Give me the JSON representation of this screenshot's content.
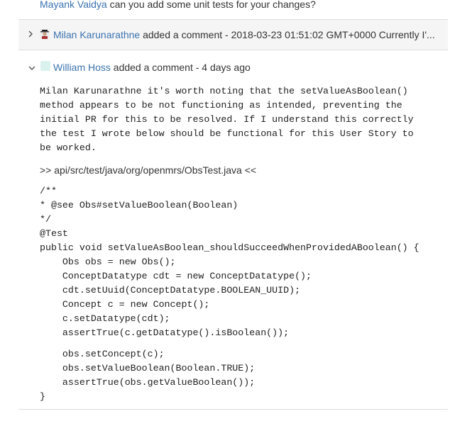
{
  "top_comment": {
    "author": "Mayank Vaidya",
    "text": " can you add some unit tests for your changes?"
  },
  "collapsed_comment": {
    "author": "Milan Karunarathne",
    "summary": " added a comment - 2018-03-23 01:51:02 GMT+0000 Currently I'..."
  },
  "expanded_comment": {
    "author": "William Hoss",
    "meta": " added a comment - 4 days ago",
    "mention": "Milan Karunarathne",
    "body_lines": [
      " it's worth noting that the setValueAsBoolean()",
      "method appears to be not functioning as intended, preventing the",
      "initial PR for this to be resolved. If I understand this correctly",
      "the test I wrote below should be functional for this User Story to",
      "be worked."
    ],
    "file_ref": ">> api/src/test/java/org/openmrs/ObsTest.java <<",
    "code_lines_1": [
      "/**",
      "* @see Obs#setValueBoolean(Boolean)",
      "*/",
      "@Test",
      "public void setValueAsBoolean_shouldSucceedWhenProvidedABoolean() {",
      "    Obs obs = new Obs();",
      "    ConceptDatatype cdt = new ConceptDatatype();",
      "    cdt.setUuid(ConceptDatatype.BOOLEAN_UUID);",
      "    Concept c = new Concept();",
      "    c.setDatatype(cdt);",
      "    assertTrue(c.getDatatype().isBoolean());"
    ],
    "code_lines_2": [
      "    obs.setConcept(c);",
      "    obs.setValueBoolean(Boolean.TRUE);",
      "    assertTrue(obs.getValueBoolean());",
      "}"
    ]
  },
  "colors": {
    "link": "#3b73af",
    "collapsed_bg": "#f5f5f5",
    "divider": "#dddddd"
  }
}
